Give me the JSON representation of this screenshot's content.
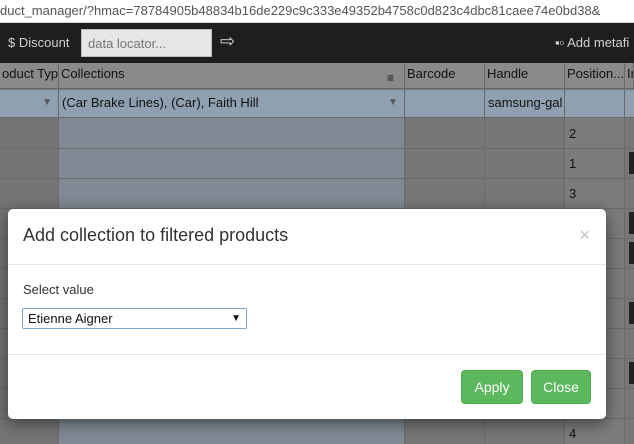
{
  "browser": {
    "url": "duct_manager/?hmac=78784905b48834b16de229c9c333e49352b4758c0d823c4dbc81caee74e0bd38&"
  },
  "toolbar": {
    "discount_label": "$ Discount",
    "locator_placeholder": "data locator...",
    "apply_locator_icon": "arrow-right-icon",
    "add_meta_label": "Add metafi"
  },
  "grid": {
    "columns": [
      "oduct Type",
      "Collections",
      "Barcode",
      "Handle",
      "Position",
      "Im"
    ],
    "filter_row": {
      "collections": "(Car Brake Lines), (Car), Faith Hill",
      "handle": "samsung-gal"
    },
    "positions": [
      "2",
      "1",
      "3",
      "4"
    ]
  },
  "modal": {
    "title": "Add collection to filtered products",
    "close_symbol": "×",
    "select_label": "Select value",
    "selected_value": "Etienne Aigner",
    "apply_label": "Apply",
    "close_label": "Close"
  },
  "colors": {
    "button_green": "#5cb85c",
    "toolbar_dark": "#1e1e1e",
    "filter_row": "#8fa0b0"
  }
}
